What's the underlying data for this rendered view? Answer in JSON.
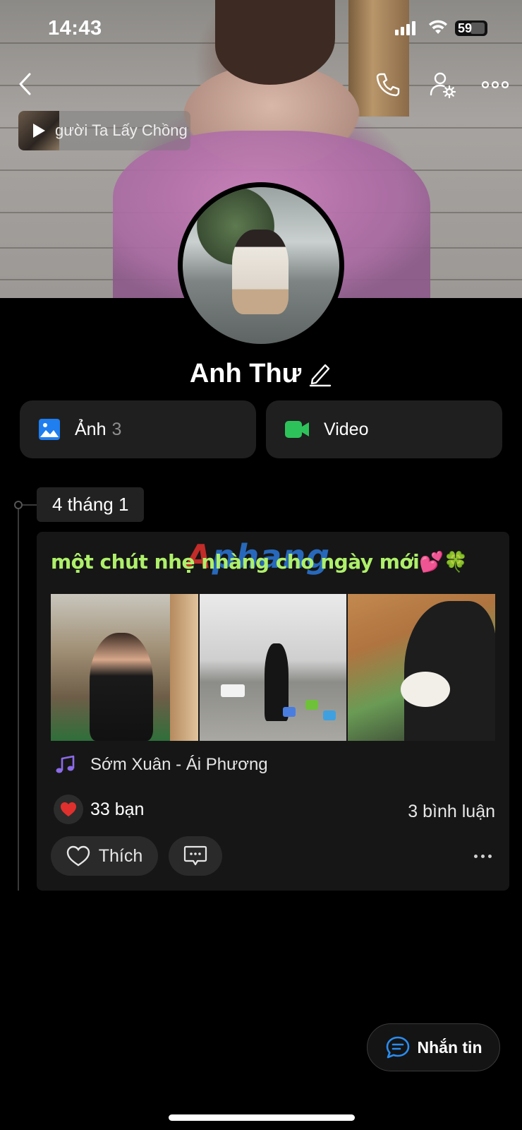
{
  "status_bar": {
    "time": "14:43",
    "battery": "59"
  },
  "cover": {
    "music_title": "gười Ta Lấy Chồng"
  },
  "profile": {
    "name": "Anh Thư"
  },
  "media": {
    "photos_label": "Ảnh",
    "photos_count": "3",
    "video_label": "Video"
  },
  "timeline": {
    "date": "4 tháng 1",
    "post": {
      "text": "một chút nhẹ nhàng cho ngày mới💕🍀",
      "watermark_a": "A",
      "watermark_rest": "phang",
      "song": "Sớm Xuân - Ái Phương",
      "reactions": "33 bạn",
      "comments": "3 bình luận",
      "like_label": "Thích"
    }
  },
  "fab": {
    "label": "Nhắn tin"
  },
  "colors": {
    "accent_blue": "#1f7ef0",
    "video_green": "#2ec25b",
    "post_text_green": "#aef06a",
    "heart_red": "#e0302d",
    "music_purple": "#8c6be8"
  },
  "icons": [
    "back-icon",
    "phone-icon",
    "user-settings-icon",
    "more-icon",
    "play-icon",
    "edit-pencil-icon",
    "image-icon",
    "video-camera-icon",
    "music-note-icon",
    "heart-icon",
    "comment-icon",
    "chat-bubble-icon"
  ]
}
